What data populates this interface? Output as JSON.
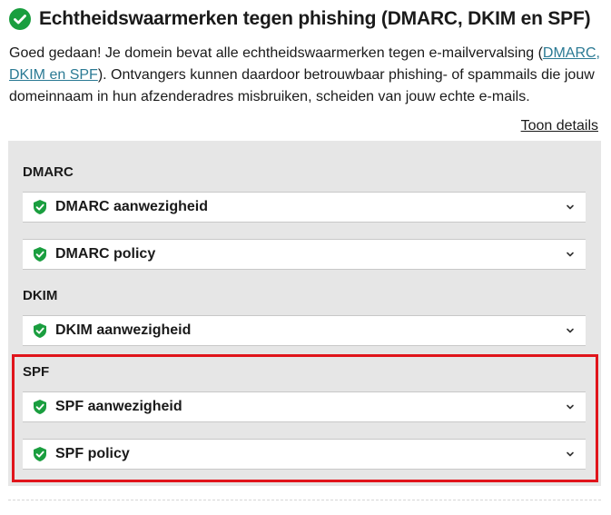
{
  "header": {
    "title": "Echtheidswaarmerken tegen phishing (DMARC, DKIM en SPF)",
    "status_icon": "check-circle-icon",
    "status_color": "#1a9e3f"
  },
  "intro": {
    "text_before_link": "Goed gedaan! Je domein bevat alle echtheidswaarmerken tegen e-mailvervalsing (",
    "link_text": "DMARC, DKIM en SPF",
    "text_after_link": "). Ontvangers kunnen daardoor betrouwbaar phishing- of spammails die jouw domeinnaam in hun afzenderadres misbruiken, scheiden van jouw echte e-mails.",
    "link_color": "#2b7a94"
  },
  "details_link": "Toon details",
  "groups": [
    {
      "label": "DMARC",
      "items": [
        {
          "label": "DMARC aanwezigheid",
          "icon": "shield-check-icon",
          "toggle_icon": "chevron-down-icon"
        },
        {
          "label": "DMARC policy",
          "icon": "shield-check-icon",
          "toggle_icon": "chevron-down-icon"
        }
      ]
    },
    {
      "label": "DKIM",
      "items": [
        {
          "label": "DKIM aanwezigheid",
          "icon": "shield-check-icon",
          "toggle_icon": "chevron-down-icon"
        }
      ]
    },
    {
      "label": "SPF",
      "items": [
        {
          "label": "SPF aanwezigheid",
          "icon": "shield-check-icon",
          "toggle_icon": "chevron-down-icon"
        },
        {
          "label": "SPF policy",
          "icon": "shield-check-icon",
          "toggle_icon": "chevron-down-icon"
        }
      ]
    }
  ],
  "colors": {
    "success": "#1a9e3f",
    "panel_background": "#e6e6e6",
    "highlight_border": "#e0141b"
  }
}
